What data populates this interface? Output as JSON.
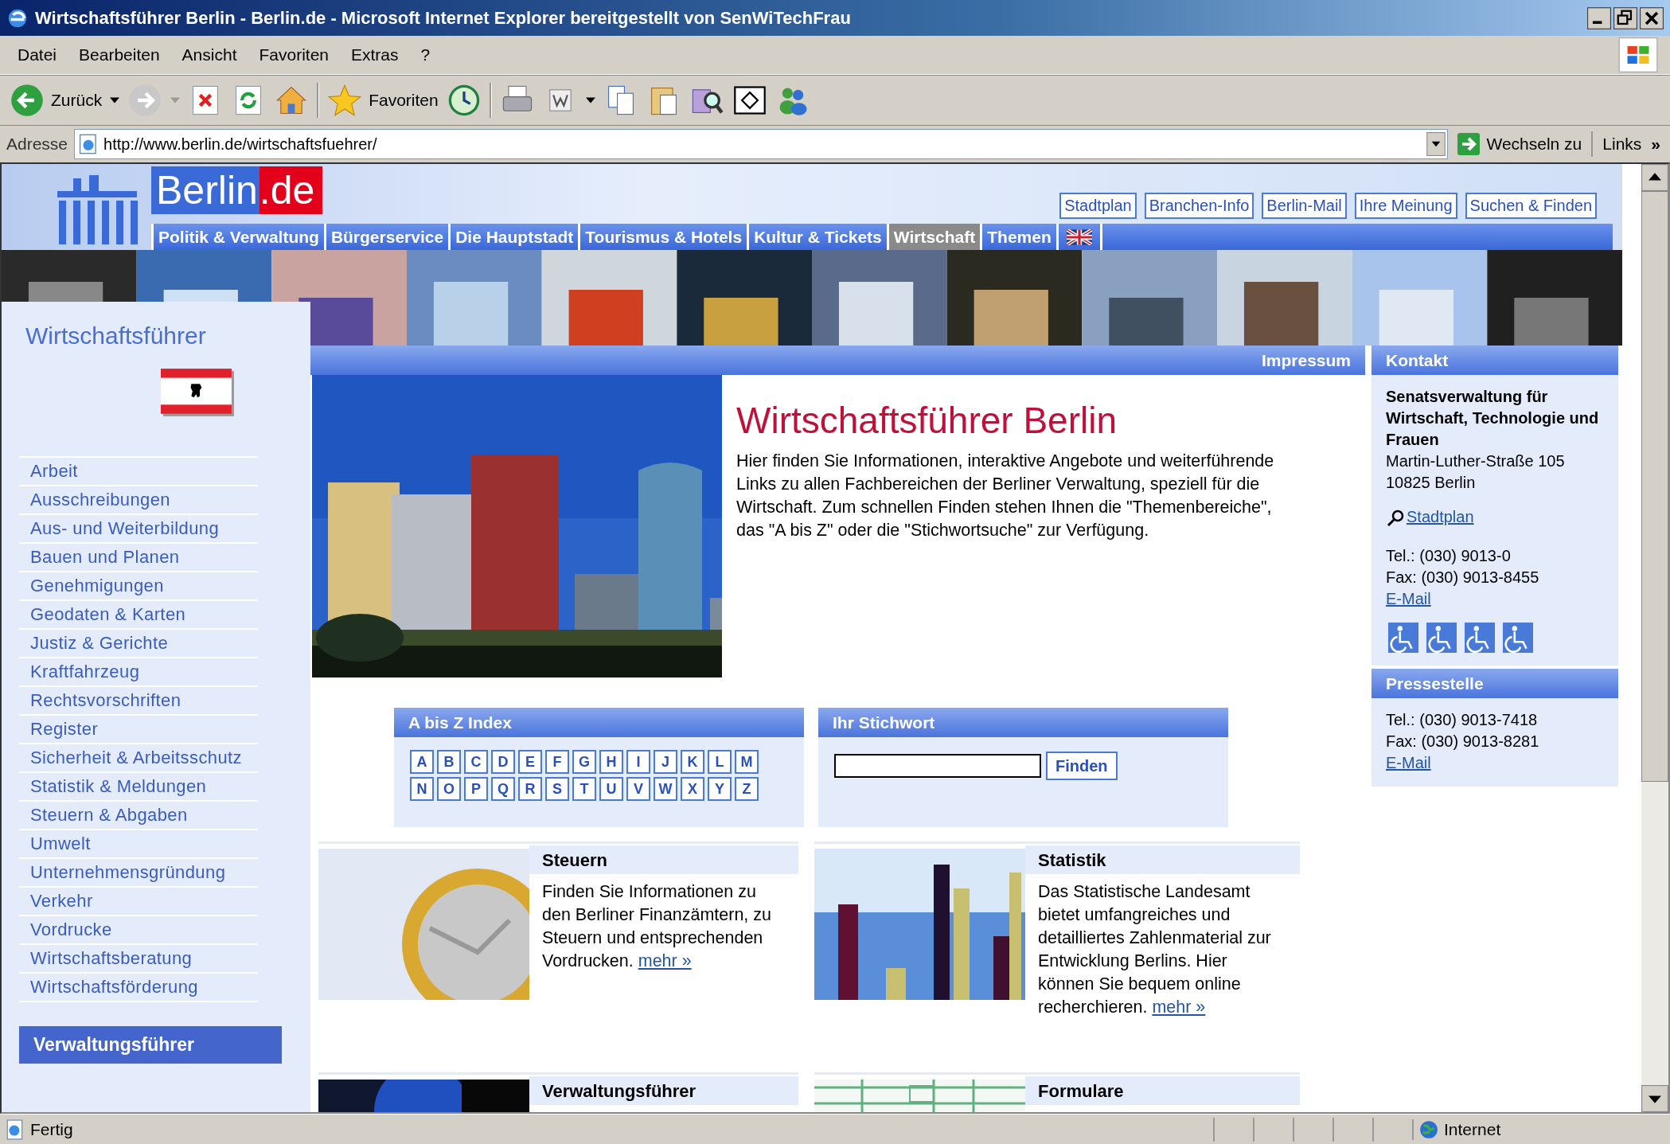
{
  "window": {
    "title": "Wirtschaftsführer Berlin - Berlin.de - Microsoft Internet Explorer bereitgestellt von SenWiTechFrau"
  },
  "menu": [
    "Datei",
    "Bearbeiten",
    "Ansicht",
    "Favoriten",
    "Extras",
    "?"
  ],
  "toolbar": {
    "back": "Zurück",
    "favorites": "Favoriten"
  },
  "address": {
    "label": "Adresse",
    "url": "http://www.berlin.de/wirtschaftsfuehrer/",
    "go": "Wechseln zu",
    "links": "Links",
    "chevron": "»"
  },
  "page": {
    "logo": {
      "name": "Berlin",
      "tld": ".de"
    },
    "top_links": [
      "Stadtplan",
      "Branchen-Info",
      "Berlin-Mail",
      "Ihre Meinung",
      "Suchen & Finden"
    ],
    "nav": [
      {
        "kind": "text",
        "label": "Politik & Verwaltung",
        "selected": false
      },
      {
        "kind": "text",
        "label": "Bürgerservice",
        "selected": false
      },
      {
        "kind": "text",
        "label": "Die Hauptstadt",
        "selected": false
      },
      {
        "kind": "text",
        "label": "Tourismus & Hotels",
        "selected": false
      },
      {
        "kind": "text",
        "label": "Kultur & Tickets",
        "selected": false
      },
      {
        "kind": "text",
        "label": "Wirtschaft",
        "selected": true
      },
      {
        "kind": "text",
        "label": "Themen",
        "selected": false
      },
      {
        "kind": "flag",
        "selected": false
      }
    ],
    "sidebar": {
      "title": "Wirtschaftsführer",
      "items": [
        "Arbeit",
        "Ausschreibungen",
        "Aus- und Weiterbildung",
        "Bauen und Planen",
        "Genehmigungen",
        "Geodaten & Karten",
        "Justiz & Gerichte",
        "Kraftfahrzeug",
        "Rechtsvorschriften",
        "Register",
        "Sicherheit & Arbeitsschutz",
        "Statistik & Meldungen",
        "Steuern & Abgaben",
        "Umwelt",
        "Unternehmensgründung",
        "Verkehr",
        "Vordrucke",
        "Wirtschaftsberatung",
        "Wirtschaftsförderung"
      ],
      "box": "Verwaltungsführer"
    },
    "impressum": "Impressum",
    "intro": {
      "title": "Wirtschaftsführer Berlin",
      "text": "Hier finden Sie Informationen, interaktive Angebote und weiterführende Links zu allen Fachbereichen der Berliner Verwaltung, speziell für die Wirtschaft. Zum schnellen Finden stehen Ihnen die \"Themenbereiche\", das \"A bis Z\" oder die \"Stichwortsuche\" zur Verfügung."
    },
    "az": {
      "title": "A bis Z Index",
      "letters": [
        "A",
        "B",
        "C",
        "D",
        "E",
        "F",
        "G",
        "H",
        "I",
        "J",
        "K",
        "L",
        "M",
        "N",
        "O",
        "P",
        "Q",
        "R",
        "S",
        "T",
        "U",
        "V",
        "W",
        "X",
        "Y",
        "Z"
      ]
    },
    "search": {
      "title": "Ihr Stichwort",
      "button": "Finden"
    },
    "cards": [
      {
        "title": "Steuern",
        "text": "Finden Sie Informationen zu den Berliner Finanzämtern, zu Steuern und entsprechenden Vordrucken.",
        "more": "mehr »"
      },
      {
        "title": "Statistik",
        "text": "Das Statistische Landesamt bietet umfangreiches und detailliertes Zahlenmaterial zur Entwicklung Berlins. Hier können Sie bequem online recherchieren.",
        "more": "mehr »"
      },
      {
        "title": "Verwaltungsführer"
      },
      {
        "title": "Formulare"
      }
    ],
    "contact": {
      "title": "Kontakt",
      "org": "Senatsverwaltung für Wirtschaft, Technologie und Frauen",
      "address": [
        "Martin-Luther-Straße 105",
        "10825 Berlin"
      ],
      "map": "Stadtplan",
      "phone": "Tel.: (030) 9013-0",
      "fax": "Fax: (030) 9013-8455",
      "email": "E-Mail"
    },
    "press": {
      "title": "Pressestelle",
      "phone": "Tel.: (030) 9013-7418",
      "fax": "Fax: (030) 9013-8281",
      "email": "E-Mail"
    }
  },
  "status": {
    "text": "Fertig",
    "zone": "Internet"
  }
}
